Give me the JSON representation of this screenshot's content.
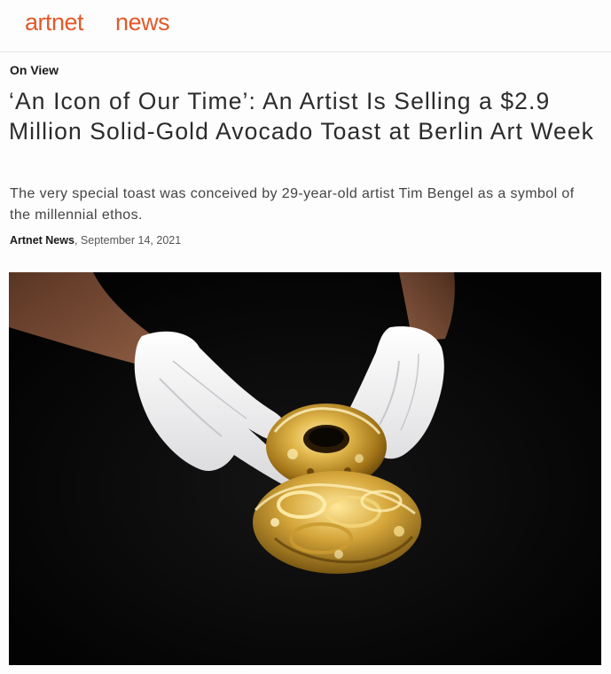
{
  "header": {
    "logo_part_1": "artnet",
    "logo_part_2": "news",
    "brand_color": "#e15a2b"
  },
  "article": {
    "kicker": "On View",
    "headline": "‘An Icon of Our Time’: An Artist Is Selling a $2.9 Million Solid-Gold Avocado Toast at Berlin Art Week",
    "dek": "The very special toast was conceived by 29-year-old artist Tim Bengel as a symbol of the millennial ethos.",
    "byline": {
      "author": "Artnet News",
      "separator": ",",
      "date": "September 14, 2021"
    }
  },
  "hero_image": {
    "subject": "gloved-hands-holding-gold-avocado-toast-photo"
  }
}
